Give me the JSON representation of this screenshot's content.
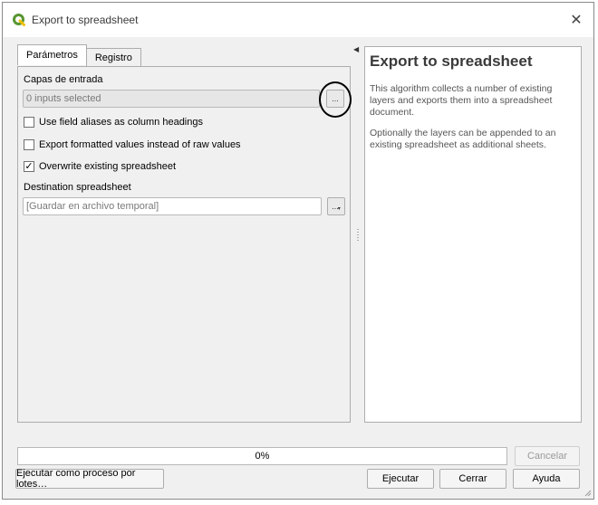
{
  "window": {
    "title": "Export to spreadsheet",
    "close_glyph": "✕"
  },
  "tabs": [
    {
      "label": "Parámetros",
      "active": true
    },
    {
      "label": "Registro",
      "active": false
    }
  ],
  "params": {
    "input_layers_label": "Capas de entrada",
    "input_layers_value": "0 inputs selected",
    "browse_glyph": "...",
    "use_aliases": {
      "label": "Use field aliases as column headings",
      "checked": false
    },
    "formatted_values": {
      "label": "Export formatted values instead of raw values",
      "checked": false
    },
    "overwrite": {
      "label": "Overwrite existing spreadsheet",
      "checked": true,
      "mark": "✓"
    },
    "destination_label": "Destination spreadsheet",
    "destination_placeholder": "[Guardar en archivo temporal]",
    "destination_btn_glyph": "..."
  },
  "help": {
    "title": "Export to spreadsheet",
    "paragraphs": [
      "This algorithm collects a number of existing layers and exports them into a spreadsheet document.",
      "Optionally the layers can be appended to an existing spreadsheet as additional sheets."
    ]
  },
  "progress": {
    "value": 0,
    "text": "0%"
  },
  "buttons": {
    "cancel": "Cancelar",
    "batch": "Ejecutar como proceso por lotes…",
    "run": "Ejecutar",
    "close": "Cerrar",
    "help": "Ayuda"
  },
  "colors": {
    "qgis_green": "#589632",
    "qgis_yellow": "#f0c000"
  }
}
